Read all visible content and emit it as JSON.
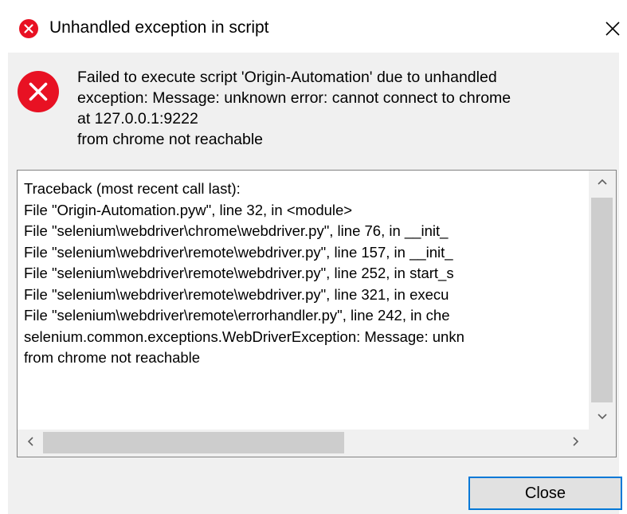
{
  "window": {
    "title": "Unhandled exception in script"
  },
  "icons": {
    "title_icon": "error-icon",
    "message_icon": "error-icon",
    "close_icon": "close-icon",
    "error_color": "#e81123"
  },
  "message": {
    "lines": [
      "Failed to execute script 'Origin-Automation' due to unhandled",
      "exception: Message: unknown error: cannot connect to chrome",
      "at 127.0.0.1:9222",
      "from chrome not reachable"
    ]
  },
  "traceback": {
    "lines": [
      "Traceback (most recent call last):",
      "  File \"Origin-Automation.pyw\", line 32, in <module>",
      "  File \"selenium\\webdriver\\chrome\\webdriver.py\", line 76, in __init_",
      "  File \"selenium\\webdriver\\remote\\webdriver.py\", line 157, in __init_",
      "  File \"selenium\\webdriver\\remote\\webdriver.py\", line 252, in start_s",
      "  File \"selenium\\webdriver\\remote\\webdriver.py\", line 321, in execu",
      "  File \"selenium\\webdriver\\remote\\errorhandler.py\", line 242, in che",
      "selenium.common.exceptions.WebDriverException: Message: unkn",
      "from chrome not reachable"
    ]
  },
  "buttons": {
    "close_label": "Close"
  }
}
